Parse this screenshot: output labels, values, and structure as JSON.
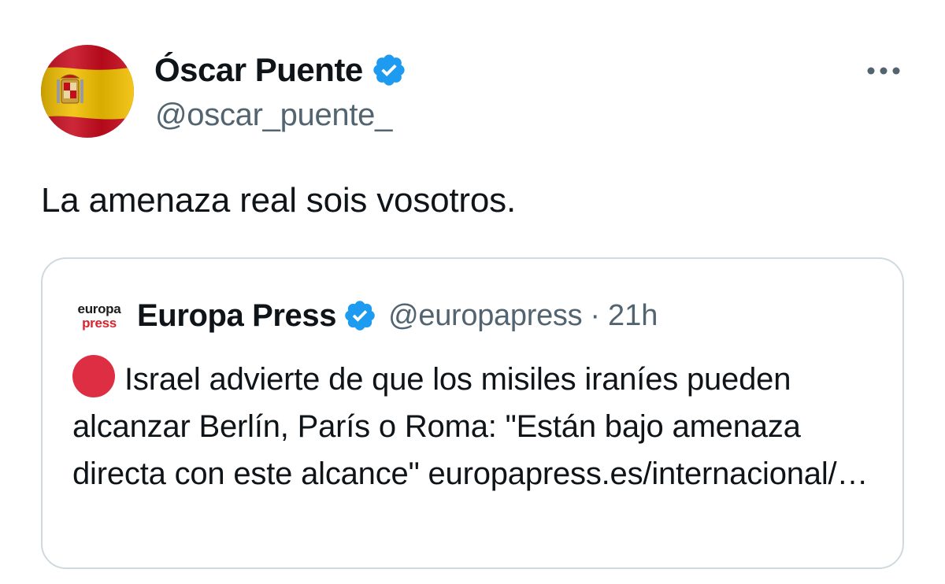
{
  "tweet": {
    "display_name": "Óscar Puente",
    "handle": "@oscar_puente_",
    "text": "La amenaza real sois vosotros.",
    "avatar_icon": "spain-flag-avatar",
    "verified_icon": "verified-badge-icon",
    "more_icon": "more-dots-icon"
  },
  "quote": {
    "logo_line1": "europa",
    "logo_line2": "press",
    "display_name": "Europa Press",
    "handle": "@europapress",
    "separator": "·",
    "time": "21h",
    "emoji_icon": "red-circle-icon",
    "text": "Israel advierte de que los misiles iraníes pueden alcanzar Berlín, París o Roma: \"Están bajo amenaza directa con este alcance\" europapress.es/internacional/…"
  },
  "colors": {
    "text_primary": "#0f1419",
    "text_secondary": "#536471",
    "verified_blue": "#1d9bf0",
    "card_border": "#cfd9de",
    "red_circle": "#dd2e44",
    "logo_red": "#d9232d"
  }
}
